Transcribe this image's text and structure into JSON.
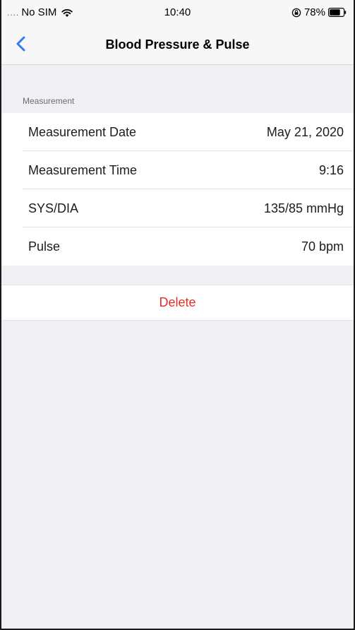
{
  "status_bar": {
    "signal": "....",
    "carrier": "No SIM",
    "time": "10:40",
    "battery_percent": "78%",
    "icons": [
      "wifi-icon",
      "orientation-lock-icon",
      "battery-icon"
    ],
    "battery_level": 0.78
  },
  "nav": {
    "back_icon": "chevron-left-icon",
    "title": "Blood Pressure & Pulse",
    "accent_color": "#2f7cf6"
  },
  "section": {
    "header": "Measurement",
    "rows": [
      {
        "label": "Measurement Date",
        "value": "May 21, 2020"
      },
      {
        "label": "Measurement Time",
        "value": "9:16"
      },
      {
        "label": "SYS/DIA",
        "value": "135/85 mmHg"
      },
      {
        "label": "Pulse",
        "value": "70 bpm"
      }
    ]
  },
  "actions": {
    "delete_label": "Delete",
    "delete_color": "#e62e28"
  }
}
